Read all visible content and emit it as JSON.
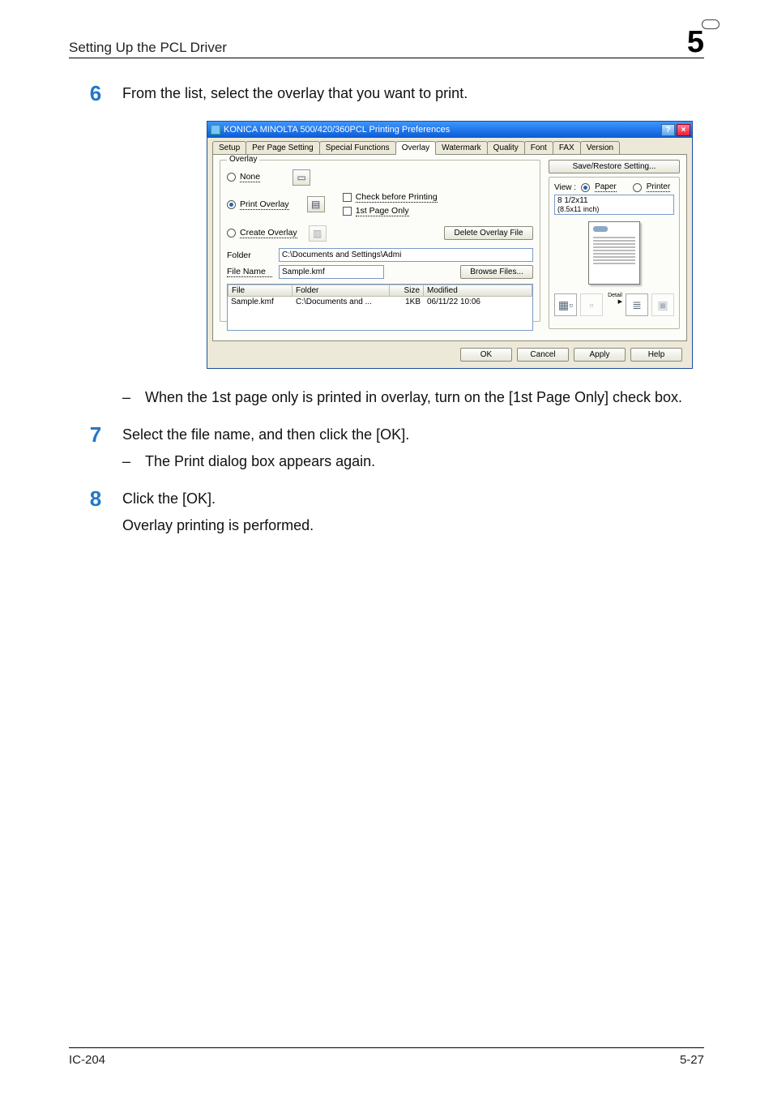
{
  "header": {
    "title": "Setting Up the PCL Driver",
    "chapter": "5"
  },
  "steps": {
    "s6": {
      "num": "6",
      "text": "From the list, select the overlay that you want to print."
    },
    "s6_sub": "When the 1st page only is printed in overlay, turn on the [1st Page Only] check box.",
    "s7": {
      "num": "7",
      "text": "Select the file name, and then click the [OK].",
      "sub": "The Print dialog box appears again."
    },
    "s8": {
      "num": "8",
      "text": "Click the [OK].",
      "sub": "Overlay printing is performed."
    }
  },
  "dialog": {
    "title": "KONICA MINOLTA 500/420/360PCL Printing Preferences",
    "tabs": [
      "Setup",
      "Per Page Setting",
      "Special Functions",
      "Overlay",
      "Watermark",
      "Quality",
      "Font",
      "FAX",
      "Version"
    ],
    "active_tab": "Overlay",
    "overlay_group": "Overlay",
    "radio_none": "None",
    "radio_print": "Print Overlay",
    "radio_create": "Create Overlay",
    "chk_check_before": "Check before Printing",
    "chk_first_page": "1st Page Only",
    "btn_delete_overlay": "Delete Overlay File",
    "lbl_folder": "Folder",
    "folder_value": "C:\\Documents and Settings\\Admi",
    "lbl_filename": "File Name",
    "filename_value": "Sample.kmf",
    "btn_browse": "Browse Files...",
    "filelist": {
      "cols": [
        "File",
        "Folder",
        "Size",
        "Modified"
      ],
      "rows": [
        {
          "file": "Sample.kmf",
          "folder": "C:\\Documents and ...",
          "size": "1KB",
          "modified": "06/11/22 10:06"
        }
      ]
    },
    "btn_save_restore": "Save/Restore Setting...",
    "view_label": "View :",
    "view_paper": "Paper",
    "view_printer": "Printer",
    "paper_size_label": "8 1/2x11",
    "paper_size_inch": "(8.5x11 inch)",
    "detail_label": "Detail ▶",
    "btn_ok": "OK",
    "btn_cancel": "Cancel",
    "btn_apply": "Apply",
    "btn_help": "Help"
  },
  "footer": {
    "left": "IC-204",
    "right": "5-27"
  },
  "dash": "–"
}
